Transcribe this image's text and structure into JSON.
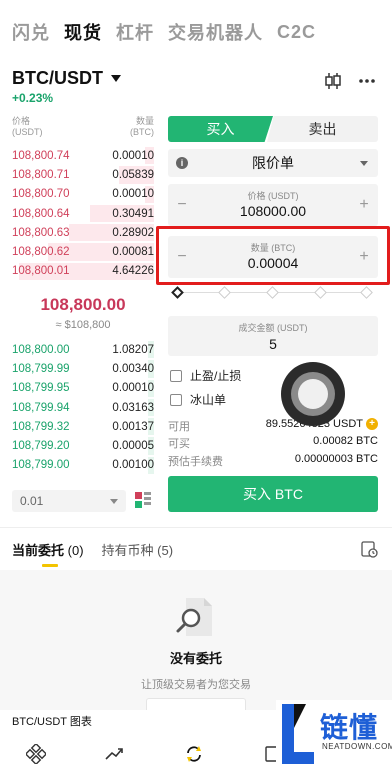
{
  "top_tabs": [
    {
      "label": "闪兑",
      "active": false
    },
    {
      "label": "现货",
      "active": true
    },
    {
      "label": "杠杆",
      "active": false
    },
    {
      "label": "交易机器人",
      "active": false
    },
    {
      "label": "C2C",
      "active": false
    }
  ],
  "pair": {
    "name": "BTC/USDT",
    "change": "+0.23%"
  },
  "order_book": {
    "price_header": "价格",
    "price_unit": "(USDT)",
    "qty_header": "数量",
    "qty_unit": "(BTC)",
    "asks": [
      {
        "price": "108,800.74",
        "qty": "0.00010",
        "depth": 0.06
      },
      {
        "price": "108,800.71",
        "qty": "0.05839",
        "depth": 0.25
      },
      {
        "price": "108,800.70",
        "qty": "0.00010",
        "depth": 0.06
      },
      {
        "price": "108,800.64",
        "qty": "0.30491",
        "depth": 0.45
      },
      {
        "price": "108,800.63",
        "qty": "0.28902",
        "depth": 0.6
      },
      {
        "price": "108,800.62",
        "qty": "0.00081",
        "depth": 0.75
      },
      {
        "price": "108,800.01",
        "qty": "4.64226",
        "depth": 0.95
      }
    ],
    "mid_price": "108,800.00",
    "mid_fiat": "≈ $108,800",
    "bids": [
      {
        "price": "108,800.00",
        "qty": "1.08207",
        "depth": 0.04
      },
      {
        "price": "108,799.99",
        "qty": "0.00340",
        "depth": 0.04
      },
      {
        "price": "108,799.95",
        "qty": "0.00010",
        "depth": 0.04
      },
      {
        "price": "108,799.94",
        "qty": "0.03163",
        "depth": 0.04
      },
      {
        "price": "108,799.32",
        "qty": "0.00137",
        "depth": 0.04
      },
      {
        "price": "108,799.20",
        "qty": "0.00005",
        "depth": 0.04
      },
      {
        "price": "108,799.00",
        "qty": "0.00100",
        "depth": 0.04
      }
    ],
    "depth_value": "0.01"
  },
  "trade": {
    "buy_label": "买入",
    "sell_label": "卖出",
    "order_type": "限价单",
    "price_label": "价格 (USDT)",
    "price_value": "108000.00",
    "qty_label": "数量 (BTC)",
    "qty_value": "0.00004",
    "total_label": "成交金额 (USDT)",
    "total_value": "5",
    "tpsl_label": "止盈/止损",
    "iceberg_label": "冰山单",
    "available_label": "可用",
    "available_value": "89.55264323 USDT",
    "buyable_label": "可买",
    "buyable_value": "0.00082 BTC",
    "fee_label": "预估手续费",
    "fee_value": "0.00000003 BTC",
    "submit_label": "买入 BTC"
  },
  "orders": {
    "tab_open": "当前委托",
    "tab_open_count": "(0)",
    "tab_holdings": "持有币种",
    "tab_holdings_count": "(5)",
    "empty_title": "没有委托",
    "empty_sub": "让顶级交易者为您交易"
  },
  "chart_bar": {
    "label": "BTC/USDT 图表"
  },
  "watermark": {
    "text": "链懂",
    "sub": "NEATDOWN.COM"
  },
  "colors": {
    "buy": "#22b573",
    "sell": "#d0405a",
    "highlight": "#e21c1c",
    "accent": "#f3c400"
  }
}
